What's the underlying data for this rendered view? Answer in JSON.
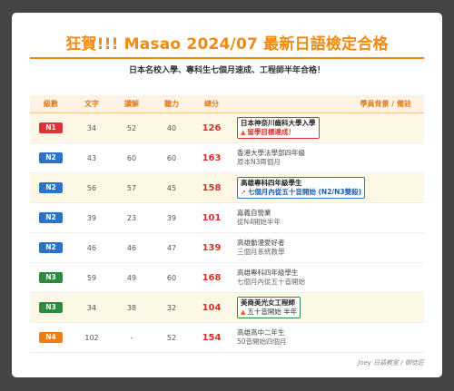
{
  "title": "狂賀!!! Masao 2024/07 最新日語檢定合格",
  "subtitle": "日本名校入學、專科生七個月速成、工程師半年合格！",
  "columns": [
    "級數",
    "文字",
    "讀解",
    "聽力",
    "總分",
    "學員背景 / 備註"
  ],
  "rows": [
    {
      "level": "N1",
      "vocab": "34",
      "reading": "52",
      "listening": "40",
      "total": "126",
      "bg1": "日本神奈川齒科大學入學",
      "bg2": "留學目標達成！"
    },
    {
      "level": "N2",
      "vocab": "43",
      "reading": "60",
      "listening": "60",
      "total": "163",
      "bg1": "香港大學法學部四年級",
      "bg2": "原本N3兩個月"
    },
    {
      "level": "N2",
      "vocab": "56",
      "reading": "57",
      "listening": "45",
      "total": "158",
      "bg1": "高雄專科四年級學生",
      "bg2": "七個月內從五十音開始 (N2/N3雙殺)"
    },
    {
      "level": "N2",
      "vocab": "39",
      "reading": "23",
      "listening": "39",
      "total": "101",
      "bg1": "嘉義自營業",
      "bg2": "從N4開始半年"
    },
    {
      "level": "N2",
      "vocab": "46",
      "reading": "46",
      "listening": "47",
      "total": "139",
      "bg1": "高雄動漫愛好者",
      "bg2": "三個月系統教學"
    },
    {
      "level": "N3",
      "vocab": "59",
      "reading": "49",
      "listening": "60",
      "total": "168",
      "bg1": "高雄專科四年級學生",
      "bg2": "七個月內從五十音開始"
    },
    {
      "level": "N3",
      "vocab": "34",
      "reading": "38",
      "listening": "32",
      "total": "104",
      "bg1": "美商美光女工程師",
      "bg2": "五十音開始 半年"
    },
    {
      "level": "N4",
      "vocab": "102",
      "reading": "-",
      "listening": "52",
      "total": "154",
      "bg1": "高雄高中二年生",
      "bg2": "50音開始四個月"
    }
  ],
  "footer": "Joey 日語教室 / 御徒匠",
  "colors": {
    "accent": "#f08a12",
    "score": "#d0342c",
    "n1": "#d8343a",
    "n2": "#2b73c8",
    "n3": "#2e8a3e",
    "n4": "#f07d14"
  }
}
